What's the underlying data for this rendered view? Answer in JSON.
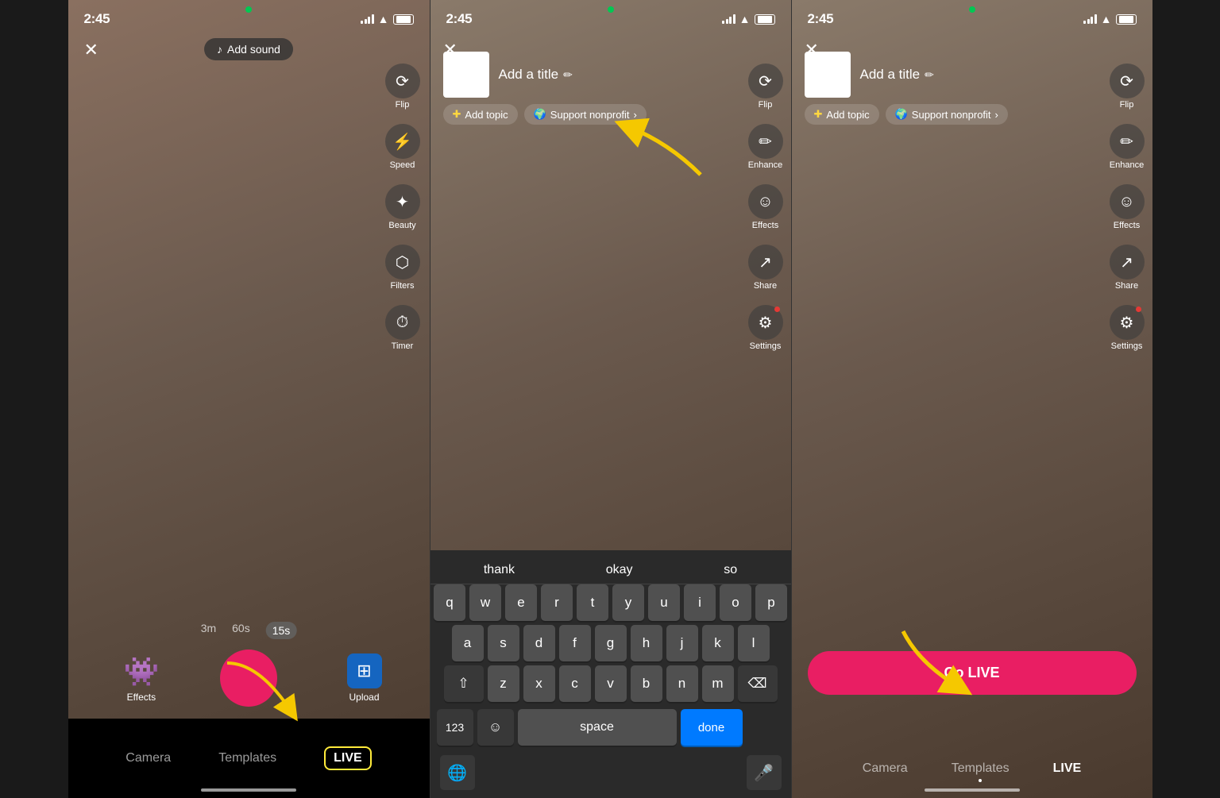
{
  "phones": [
    {
      "id": "phone1",
      "statusBar": {
        "time": "2:45",
        "greenDot": true
      },
      "addSoundLabel": "Add sound",
      "rightSidebar": [
        {
          "icon": "📷",
          "label": "Flip"
        },
        {
          "icon": "⚡",
          "label": "Speed"
        },
        {
          "icon": "✨",
          "label": "Beauty"
        },
        {
          "icon": "🔮",
          "label": "Filters"
        },
        {
          "icon": "⏱",
          "label": "Timer"
        }
      ],
      "durations": [
        {
          "label": "3m",
          "active": false
        },
        {
          "label": "60s",
          "active": false
        },
        {
          "label": "15s",
          "active": true
        }
      ],
      "effects": "Effects",
      "upload": "Upload",
      "bottomTabs": [
        {
          "label": "Camera",
          "active": false,
          "dot": false
        },
        {
          "label": "Templates",
          "active": false,
          "dot": false
        },
        {
          "label": "LIVE",
          "active": true,
          "highlighted": true
        }
      ]
    },
    {
      "id": "phone2",
      "statusBar": {
        "time": "2:45",
        "greenDot": true
      },
      "titlePlaceholder": "Add a title",
      "addTopicLabel": "Add topic",
      "supportNonprofitLabel": "Support nonprofit",
      "keyboardSuggestions": [
        "thank",
        "okay",
        "so"
      ],
      "keyRows": [
        [
          "q",
          "w",
          "e",
          "r",
          "t",
          "y",
          "u",
          "i",
          "o",
          "p"
        ],
        [
          "a",
          "s",
          "d",
          "f",
          "g",
          "h",
          "j",
          "k",
          "l"
        ],
        [
          "⇧",
          "z",
          "x",
          "c",
          "v",
          "b",
          "n",
          "m",
          "⌫"
        ],
        [
          "123",
          "😊",
          "space",
          "done"
        ]
      ]
    },
    {
      "id": "phone3",
      "statusBar": {
        "time": "2:45",
        "greenDot": true
      },
      "titlePlaceholder": "Add a title",
      "addTopicLabel": "Add topic",
      "supportNonprofitLabel": "Support nonprofit",
      "goLiveLabel": "Go LIVE",
      "rightSidebar": [
        {
          "icon": "📷",
          "label": "Flip"
        },
        {
          "icon": "✏️",
          "label": "Enhance"
        },
        {
          "icon": "😊",
          "label": "Effects"
        },
        {
          "icon": "↗️",
          "label": "Share"
        },
        {
          "icon": "⚙️",
          "label": "Settings",
          "redDot": true
        }
      ],
      "bottomTabs": [
        {
          "label": "Camera",
          "active": false
        },
        {
          "label": "Templates",
          "active": false,
          "dot": true
        },
        {
          "label": "LIVE",
          "active": true
        }
      ]
    }
  ],
  "colors": {
    "accent": "#e91e63",
    "liveHighlight": "#ffeb3b",
    "doneKey": "#007aff",
    "tagBg": "rgba(255,255,255,0.15)"
  }
}
